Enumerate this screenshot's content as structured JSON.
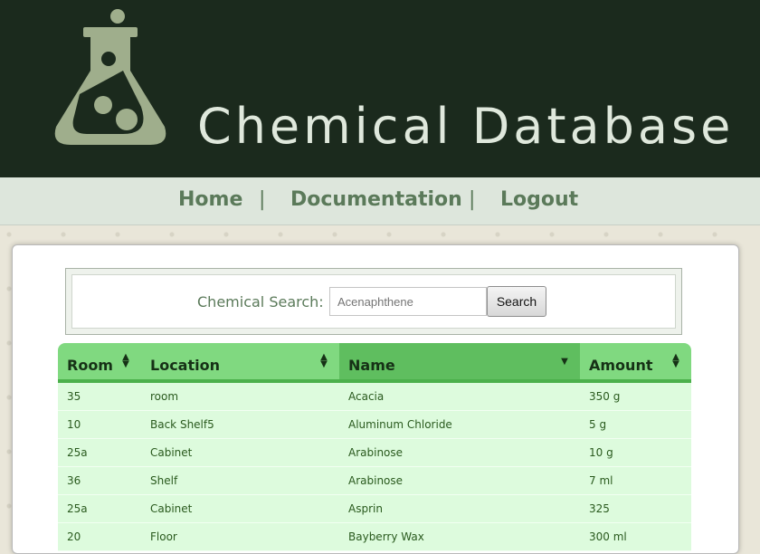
{
  "header": {
    "title": "Chemical Database",
    "logo_icon": "flask-icon"
  },
  "nav": {
    "items": [
      {
        "label": "Home"
      },
      {
        "label": "Documentation"
      },
      {
        "label": "Logout"
      }
    ],
    "separator": "|"
  },
  "search": {
    "label": "Chemical Search:",
    "value": "",
    "placeholder": "Acenaphthene",
    "button_label": "Search"
  },
  "table": {
    "columns": [
      {
        "label": "Room",
        "sort": "both"
      },
      {
        "label": "Location",
        "sort": "both"
      },
      {
        "label": "Name",
        "sort": "descending"
      },
      {
        "label": "Amount",
        "sort": "both"
      }
    ],
    "rows": [
      [
        "35",
        "room",
        "Acacia",
        "350 g"
      ],
      [
        "10",
        "Back Shelf5",
        "Aluminum Chloride",
        "5 g"
      ],
      [
        "25a",
        "Cabinet",
        "Arabinose",
        "10 g"
      ],
      [
        "36",
        "Shelf",
        "Arabinose",
        "7 ml"
      ],
      [
        "25a",
        "Cabinet",
        "Asprin",
        "325"
      ],
      [
        "20",
        "Floor",
        "Bayberry Wax",
        "300 ml"
      ]
    ]
  },
  "colors": {
    "header_bg": "#1b2a1d",
    "nav_bg": "#dde6dc",
    "nav_text": "#5b7a5a",
    "table_header": "#80d980",
    "table_header_sorted": "#5fbe5f",
    "table_row": "#ddfbdd",
    "table_text": "#2a5a1e"
  }
}
